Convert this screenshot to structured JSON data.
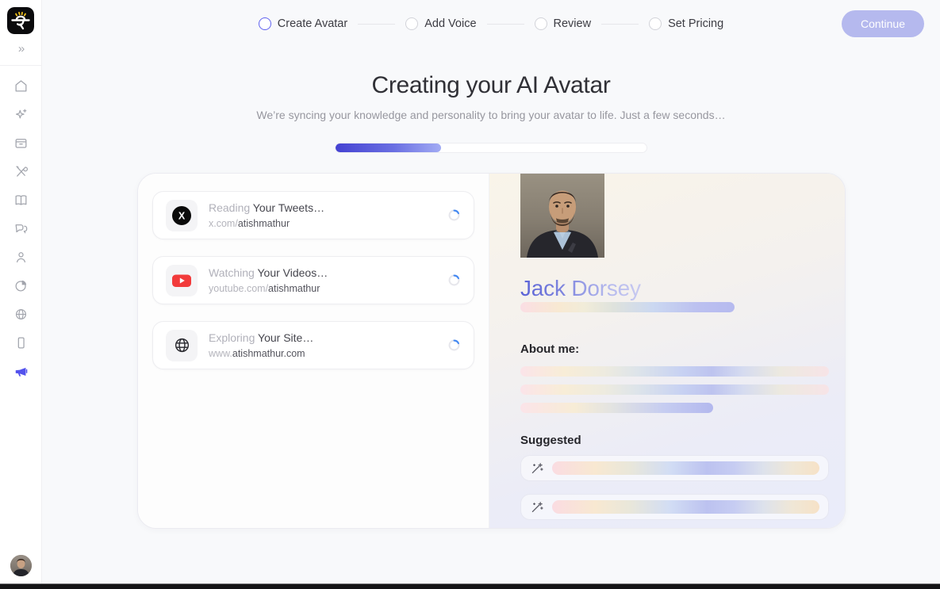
{
  "sidebar": {
    "collapse_icon": "»",
    "logo": "genie-logo",
    "items": [
      {
        "icon": "home"
      },
      {
        "icon": "sparkles"
      },
      {
        "icon": "archive"
      },
      {
        "icon": "tools"
      },
      {
        "icon": "book"
      },
      {
        "icon": "chats"
      },
      {
        "icon": "person"
      },
      {
        "icon": "pie-chart"
      },
      {
        "icon": "globe"
      },
      {
        "icon": "phone"
      },
      {
        "icon": "megaphone",
        "active": true
      }
    ]
  },
  "header": {
    "steps": [
      {
        "label": "Create Avatar",
        "active": true
      },
      {
        "label": "Add Voice",
        "active": false
      },
      {
        "label": "Review",
        "active": false
      },
      {
        "label": "Set Pricing",
        "active": false
      }
    ],
    "continue_label": "Continue"
  },
  "main": {
    "title": "Creating your AI Avatar",
    "subtitle": "We’re syncing your knowledge and personality to bring your avatar to life. Just a few seconds…",
    "progress_percent": 34
  },
  "tasks": [
    {
      "icon": "x-logo",
      "title_muted": "Reading ",
      "title_rest": "Your Tweets…",
      "url_muted": "x.com/",
      "url_rest": "atishmathur"
    },
    {
      "icon": "youtube-logo",
      "title_muted": "Watching ",
      "title_rest": "Your Videos…",
      "url_muted": "youtube.com/",
      "url_rest": "atishmathur"
    },
    {
      "icon": "globe",
      "title_muted": "Exploring ",
      "title_rest": "Your Site…",
      "url_muted": "www.",
      "url_rest": "atishmathur.com"
    }
  ],
  "profile": {
    "name": "Jack Dorsey",
    "about_label": "About me:",
    "suggested_label": "Suggested"
  },
  "colors": {
    "accent_indigo": "#5352ed",
    "progress_start": "#4542d2",
    "progress_end": "#a2abf4",
    "continue_bg": "#b5b9ee",
    "youtube_red": "#f34444",
    "spinner_blue": "#4187f2"
  }
}
